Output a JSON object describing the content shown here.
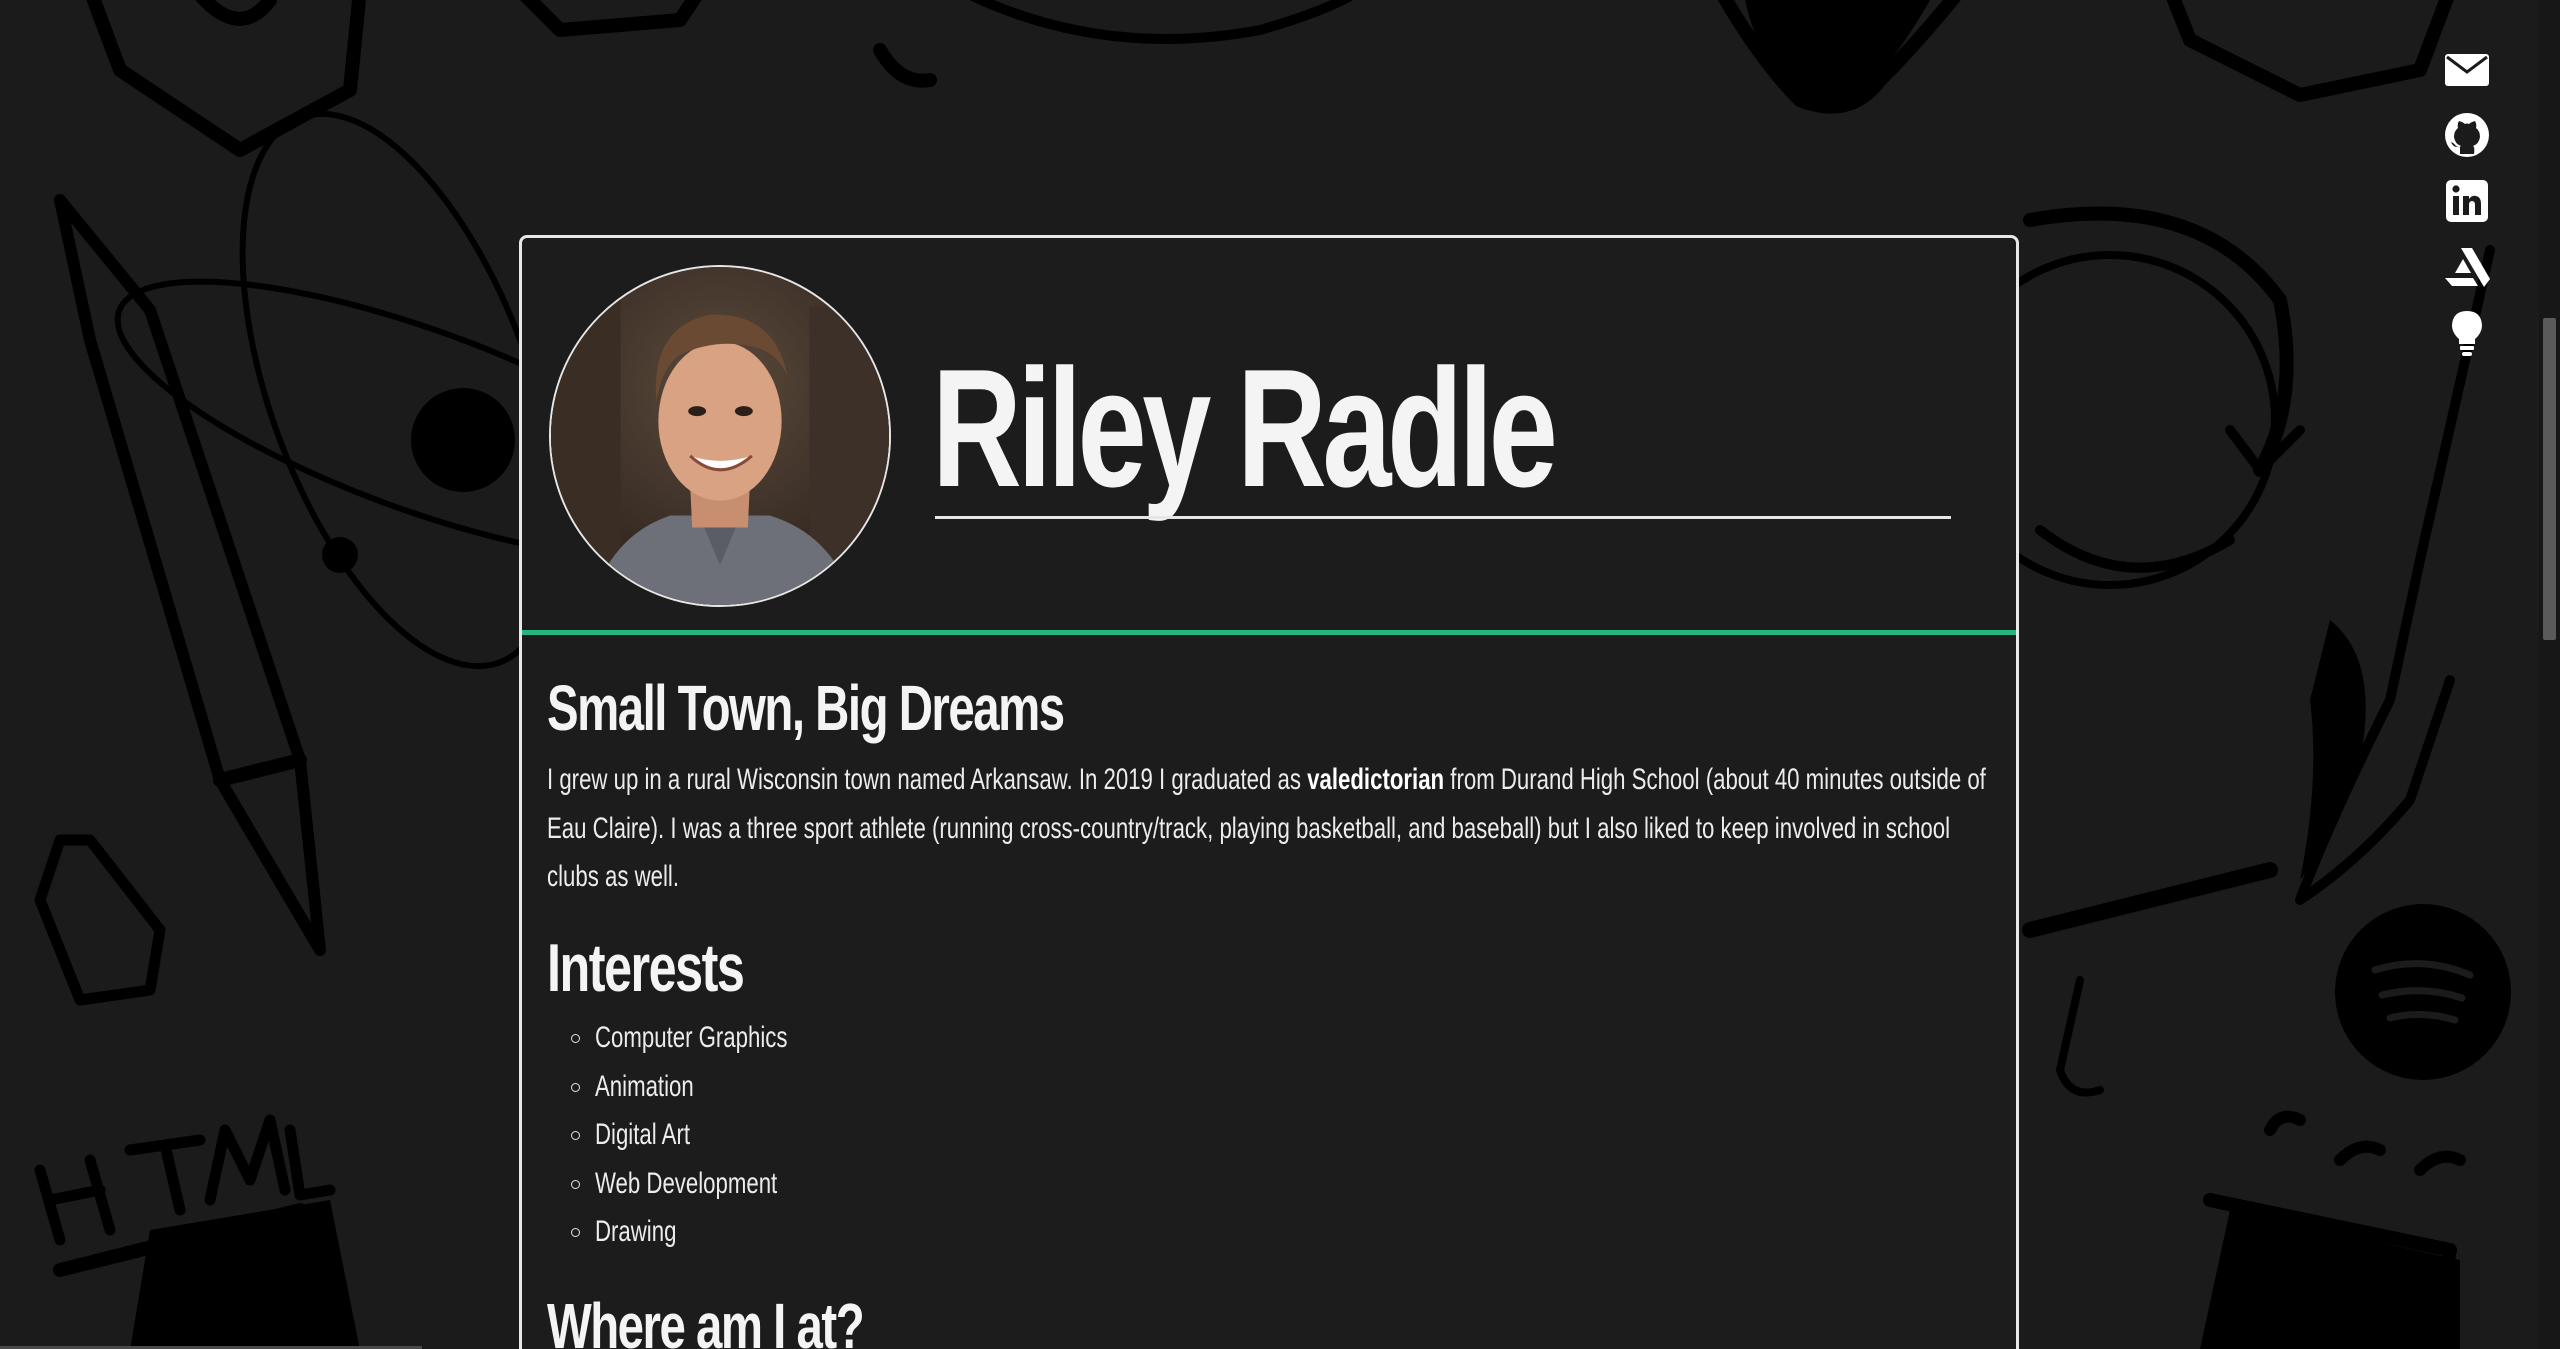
{
  "profile": {
    "name": "Riley Radle"
  },
  "social": [
    {
      "icon": "envelope-icon",
      "label": "Email"
    },
    {
      "icon": "github-icon",
      "label": "GitHub"
    },
    {
      "icon": "linkedin-icon",
      "label": "LinkedIn"
    },
    {
      "icon": "artstation-icon",
      "label": "ArtStation"
    },
    {
      "icon": "lightbulb-icon",
      "label": "Ideas"
    }
  ],
  "sections": {
    "origin": {
      "title": "Small Town, Big Dreams",
      "bio_part1": "I grew up in a rural Wisconsin town named Arkansaw. In 2019 I graduated as ",
      "bio_bold": "valedictorian",
      "bio_part2": " from Durand High School (about 40 minutes outside of Eau Claire). I was a three sport athlete (running cross-country/track, playing basketball, and baseball) but I also liked to keep involved in school clubs as well."
    },
    "interests": {
      "title": "Interests",
      "items": [
        "Computer Graphics",
        "Animation",
        "Digital Art",
        "Web Development",
        "Drawing"
      ]
    },
    "location": {
      "title": "Where am I at?"
    }
  },
  "colors": {
    "background": "#1b1b1b",
    "card": "#1c1c1c",
    "accent": "#27b57f",
    "text": "#f2f2f2",
    "border": "#e8e8e8"
  }
}
